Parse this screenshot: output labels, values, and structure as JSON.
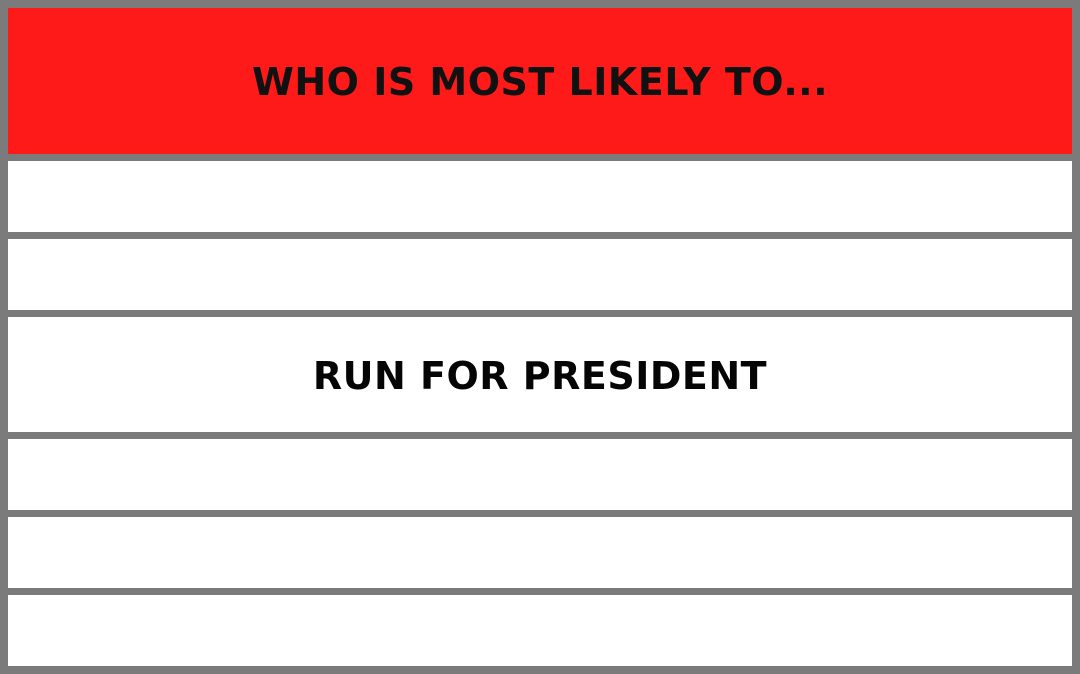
{
  "colors": {
    "header_background": "#ff1a1a",
    "border": "#7b7b7b",
    "row_background": "#ffffff",
    "text": "#111111"
  },
  "header": {
    "title": "WHO IS MOST LIKELY TO..."
  },
  "rows": [
    {
      "text": ""
    },
    {
      "text": ""
    },
    {
      "text": "RUN FOR PRESIDENT"
    },
    {
      "text": ""
    },
    {
      "text": ""
    },
    {
      "text": ""
    }
  ]
}
